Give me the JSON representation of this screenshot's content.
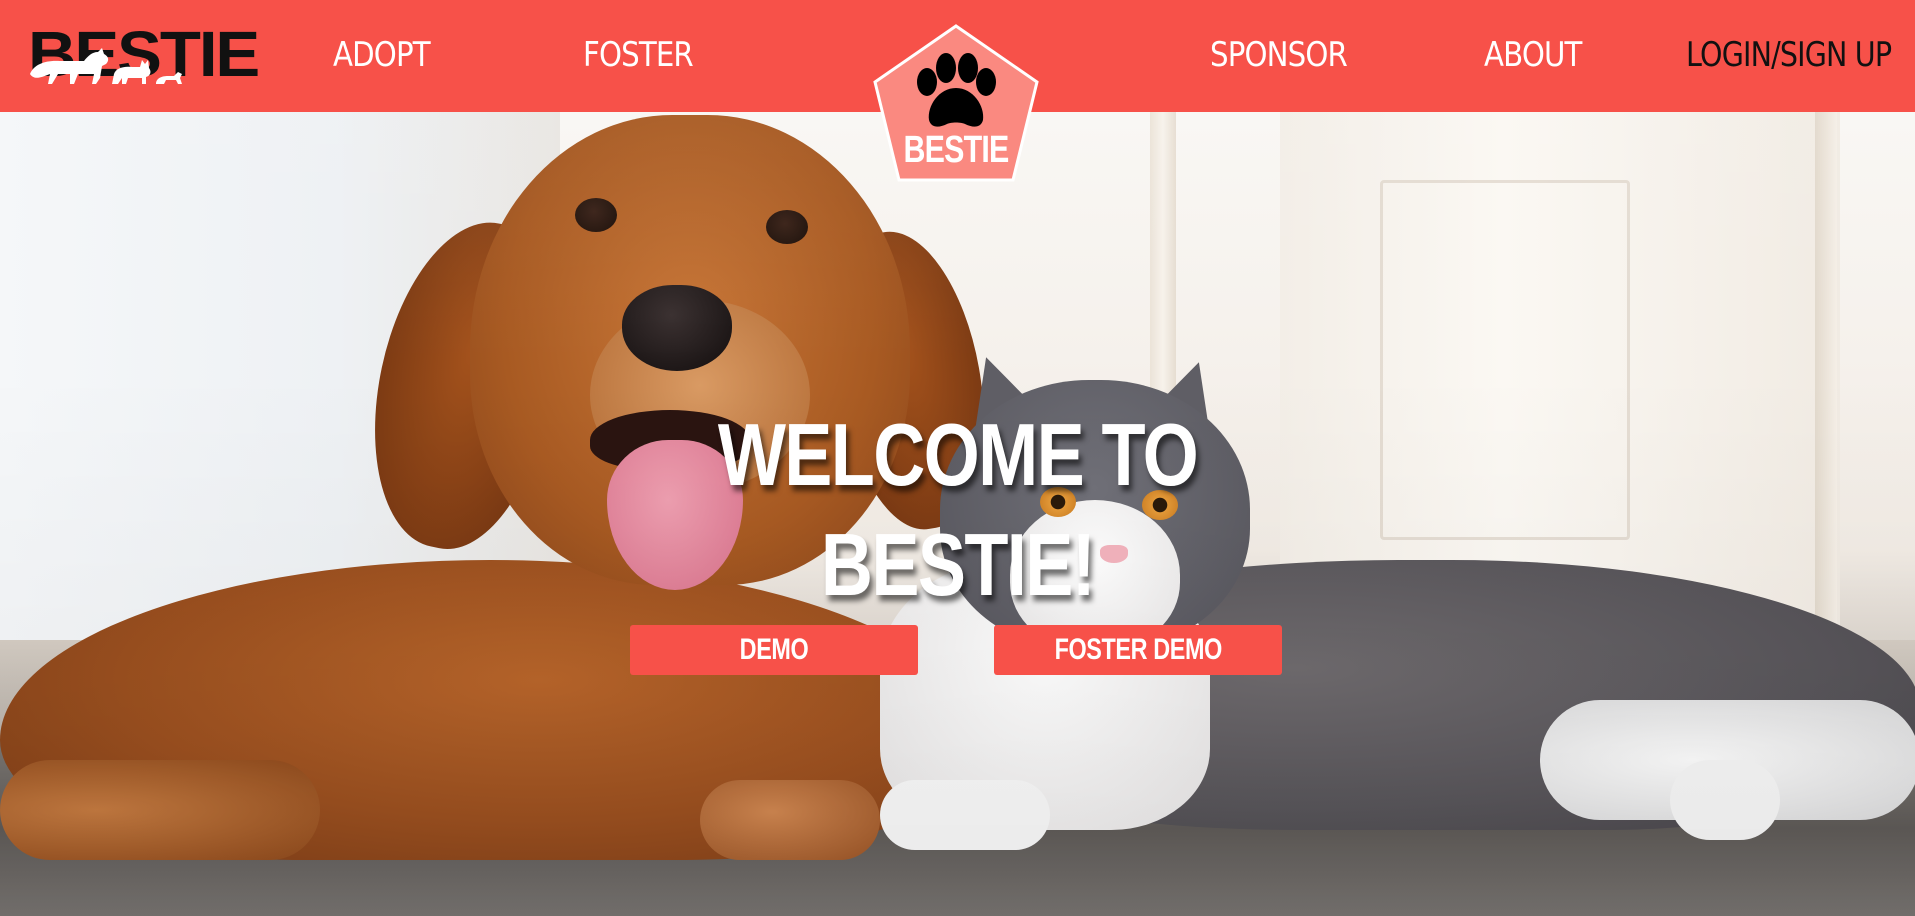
{
  "brand": {
    "logo_text": "BESTIE",
    "badge_text": "BESTIE"
  },
  "nav": {
    "adopt": "ADOPT",
    "foster": "FOSTER",
    "sponsor": "SPONSOR",
    "about": "ABOUT",
    "login": "LOGIN/SIGN UP"
  },
  "hero": {
    "title": "WELCOME TO BESTIE!",
    "demo_button": "DEMO",
    "foster_demo_button": "FOSTER DEMO",
    "background_image": "golden-retriever-and-gray-white-cat-photo"
  },
  "icons": {
    "badge_icon": "paw-icon",
    "logo_silhouettes": "pets-silhouette-icon"
  },
  "colors": {
    "brand_red": "#f75149",
    "badge_pink": "#fa8980",
    "text_white": "#ffffff",
    "text_dark": "#111111"
  }
}
